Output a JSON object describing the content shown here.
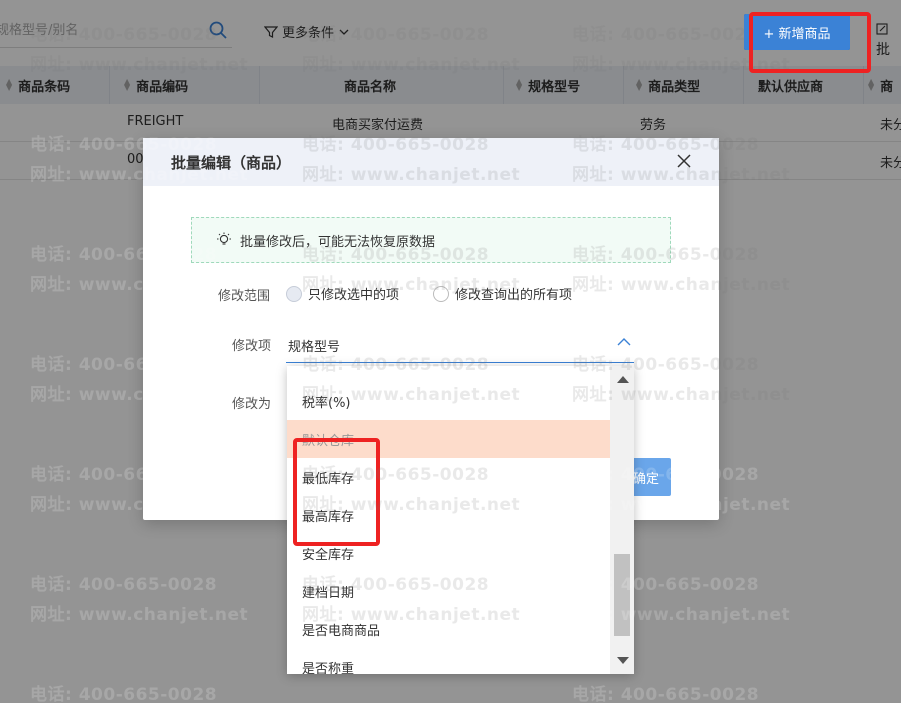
{
  "toolbar": {
    "search_placeholder": "规格型号/别名",
    "more_filter_label": "更多条件",
    "add_button_label": "+ 新增商品",
    "batch_label": "批"
  },
  "table": {
    "columns": [
      "商品条码",
      "商品编码",
      "商品名称",
      "规格型号",
      "商品类型",
      "默认供应商",
      "商"
    ],
    "rows": [
      {
        "code": "FREIGHT",
        "name": "电商买家付运费",
        "type": "劳务",
        "last": "未分"
      },
      {
        "code": "00",
        "name": "",
        "type": "",
        "last": "未分"
      }
    ]
  },
  "watermark": {
    "phone": "电话: 400-665-0028",
    "site": "网址: www.chanjet.net"
  },
  "modal": {
    "title": "批量编辑（商品）",
    "tip": "批量修改后，可能无法恢复原数据",
    "scope_label": "修改范围",
    "scope_option_1": "只修改选中的项",
    "scope_option_2": "修改查询出的所有项",
    "field_label": "修改项",
    "field_value": "规格型号",
    "change_to_label": "修改为",
    "confirm_label": "确定"
  },
  "dropdown": {
    "items": [
      "税率(%)",
      "默认仓库",
      "最低库存",
      "最高库存",
      "安全库存",
      "建档日期",
      "是否电商商品",
      "是否称重"
    ]
  }
}
